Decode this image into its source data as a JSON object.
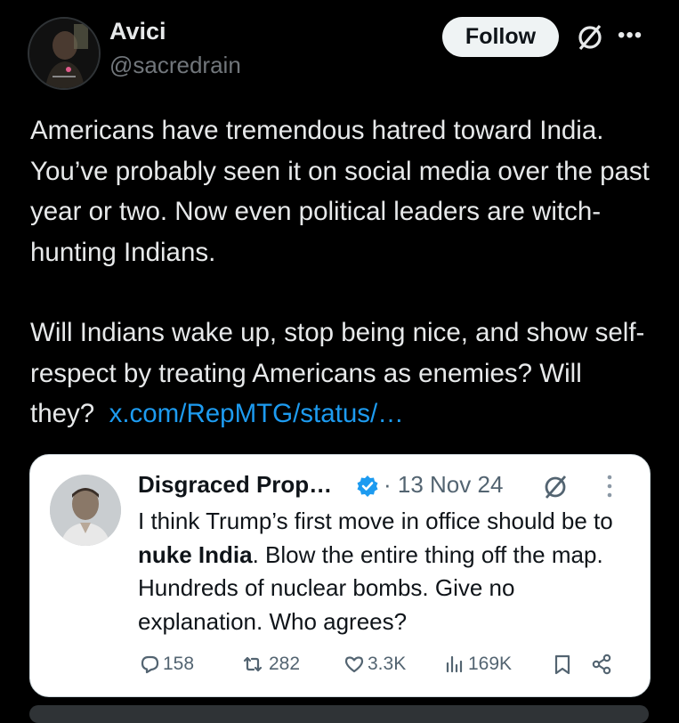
{
  "author": {
    "name": "Avici",
    "handle": "@sacredrain"
  },
  "header": {
    "follow_label": "Follow",
    "grok_icon": "grok-icon",
    "more_icon": "more-icon"
  },
  "post": {
    "paragraph1": "Americans have tremendous hatred toward India. You’ve probably seen it on social media over the past year or two. Now even political leaders are witch-hunting Indians.",
    "paragraph2_text": "Will Indians wake up, stop being nice, and show self-respect by treating Americans as enemies? Will they?",
    "paragraph2_link": "x.com/RepMTG/status/…"
  },
  "quoted": {
    "name": "Disgraced Prop…",
    "date": "· 13 Nov 24",
    "text_before": "I think Trump’s first move in office should be to ",
    "text_bold": "nuke India",
    "text_after": ". Blow the entire thing off the map. Hundreds of nuclear bombs. Give no explanation. Who agrees?",
    "actions": {
      "replies": "158",
      "reposts": "282",
      "likes": "3.3K",
      "views": "169K"
    }
  },
  "colors": {
    "link": "#1d9bf0",
    "verified": "#1d9bf0",
    "background": "#000000",
    "card_background": "#ffffff"
  }
}
